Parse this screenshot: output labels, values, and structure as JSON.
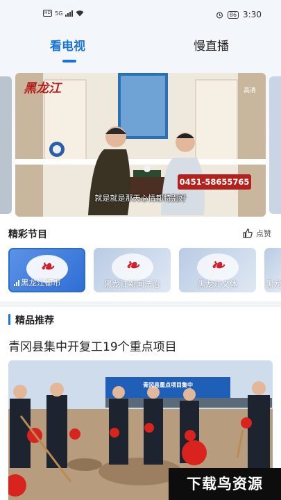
{
  "status_bar": {
    "network_label": "HD",
    "signal_label": "5G",
    "battery_level": "86",
    "time": "3:30",
    "icons": [
      "hd-icon",
      "signal-icon",
      "wifi-icon",
      "alarm-icon",
      "battery-icon"
    ]
  },
  "tabs": [
    {
      "label": "看电视",
      "active": true
    },
    {
      "label": "慢直播",
      "active": false
    }
  ],
  "hero": {
    "phone": "0451-58655765",
    "caption": "就是就是那天心情都特别好",
    "watermark": "黑龙江",
    "corner_text": "高清"
  },
  "programs": {
    "title": "精彩节目",
    "like_label": "点赞",
    "channels": [
      {
        "label": "黑龙江都市",
        "live": true
      },
      {
        "label": "黑龙江新闻法治",
        "live": false
      },
      {
        "label": "黑龙江文体",
        "live": false
      },
      {
        "label": "黑龙",
        "live": false
      }
    ]
  },
  "recommend": {
    "title": "精品推荐",
    "headline": "青冈县集中开复工19个重点项目",
    "banner": "青冈县重点项目集中"
  },
  "brand": "下载鸟资源",
  "colors": {
    "accent": "#1a73d6",
    "phone_red": "#b3211c",
    "logo_red": "#d2202a"
  }
}
